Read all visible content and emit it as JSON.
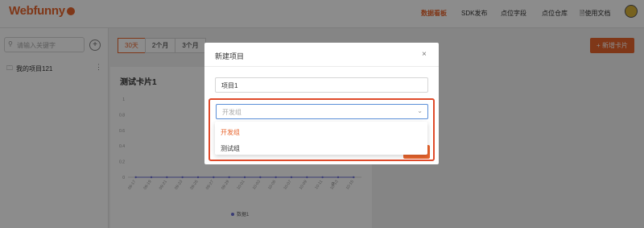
{
  "app": {
    "logo": "Webfunny"
  },
  "nav": {
    "items": [
      "数据看板",
      "SDK发布",
      "点位字段",
      "点位仓库",
      "使用文档"
    ],
    "active": "数据看板"
  },
  "sidebar": {
    "search_placeholder": "请输入关键字",
    "add_symbol": "+",
    "project": "我的项目121"
  },
  "toolbar": {
    "ranges": [
      "30天",
      "2个月",
      "3个月"
    ],
    "active_range": "30天",
    "add_card": "+ 新增卡片"
  },
  "card": {
    "title": "测试卡片1"
  },
  "chart_data": {
    "type": "line",
    "title": "测试卡片1",
    "categories": [
      "09-17",
      "09-19",
      "09-21",
      "09-23",
      "09-25",
      "09-27",
      "09-29",
      "10-01",
      "10-03",
      "10-05",
      "10-07",
      "10-09",
      "10-11",
      "10-13",
      "10-15"
    ],
    "y_ticks": [
      "1",
      "0.8",
      "0.6",
      "0.4",
      "0.2",
      "0"
    ],
    "ylim": [
      0,
      1
    ],
    "series": [
      {
        "name": "数据1",
        "values": [
          0,
          0,
          0,
          0,
          0,
          0,
          0,
          0,
          0,
          0,
          0,
          0,
          0,
          0,
          0
        ]
      }
    ],
    "point_label": "0",
    "legend": "bottom"
  },
  "modal": {
    "title": "新建项目",
    "close": "×",
    "name_value": "项目1",
    "group_placeholder": "开发组",
    "options": [
      "开发组",
      "测试组"
    ],
    "selected_option": "开发组"
  },
  "colors": {
    "accent": "#e8642c",
    "highlight": "#e04a2a",
    "focus": "#5b8fd8"
  }
}
